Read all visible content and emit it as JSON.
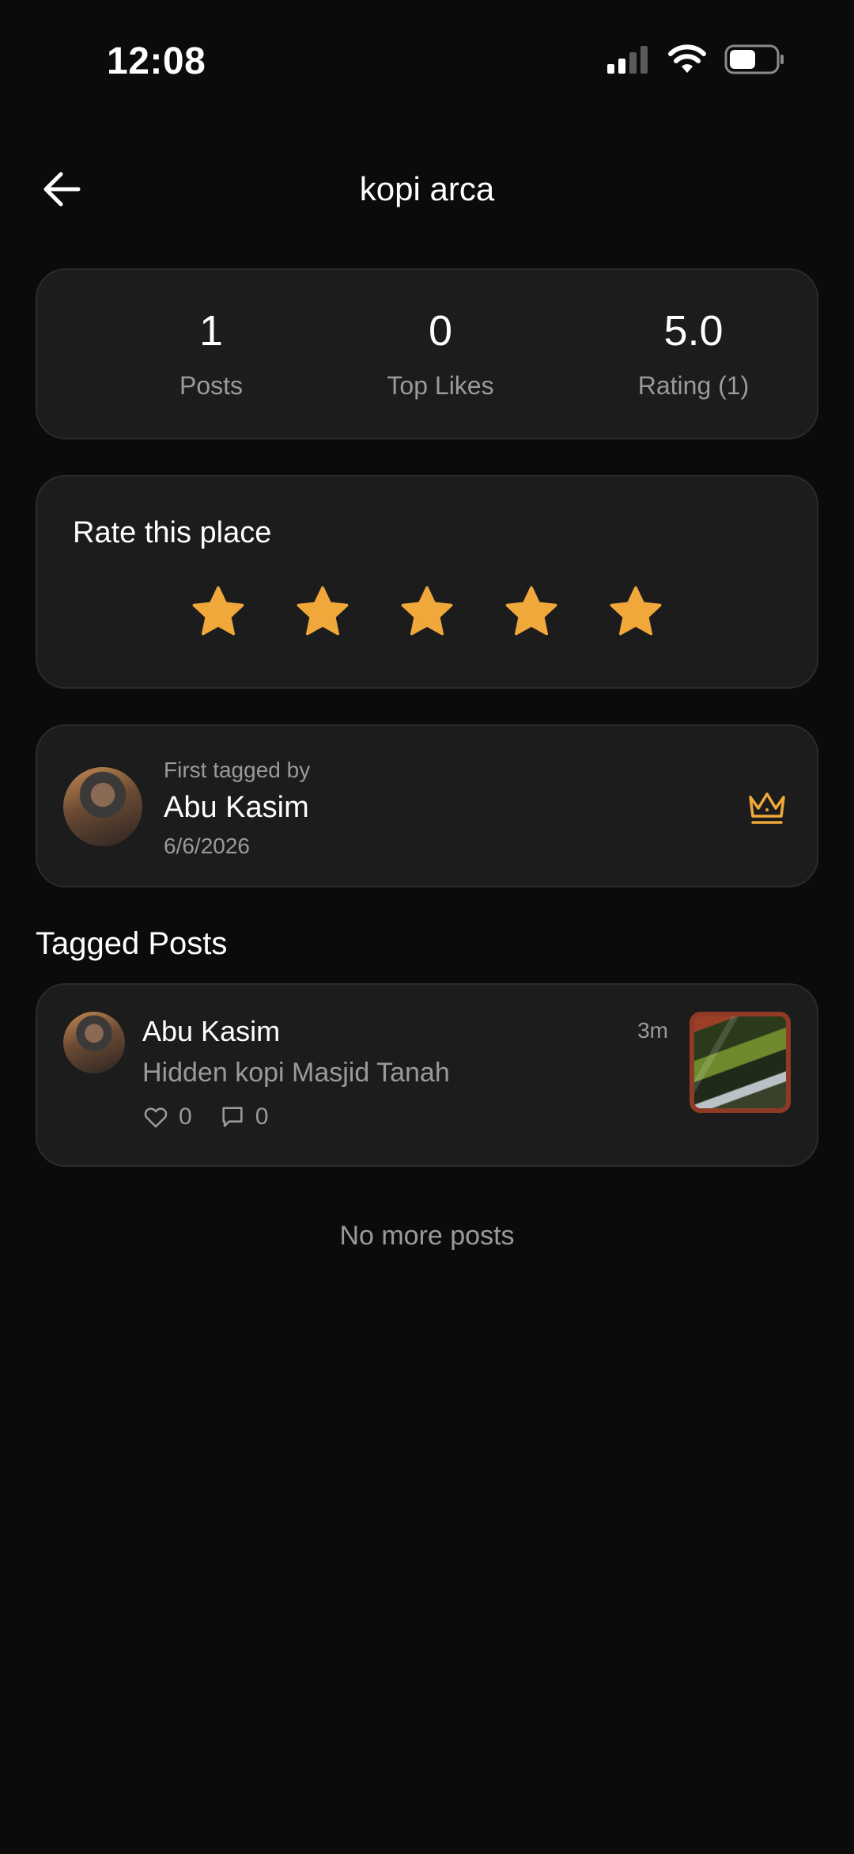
{
  "status_bar": {
    "time": "12:08",
    "icons": [
      "signal-icon",
      "wifi-icon",
      "battery-icon"
    ]
  },
  "header": {
    "title": "kopi arca",
    "back_icon": "arrow-left-icon"
  },
  "stats": [
    {
      "value": "1",
      "label": "Posts"
    },
    {
      "value": "0",
      "label": "Top Likes"
    },
    {
      "value": "5.0",
      "label": "Rating (1)"
    }
  ],
  "rate": {
    "title": "Rate this place",
    "selected_stars": 5,
    "max_stars": 5,
    "star_color": "#F0A83A"
  },
  "first_tagged": {
    "label": "First tagged by",
    "name": "Abu Kasim",
    "date": "6/6/2026",
    "badge_icon": "crown-icon"
  },
  "tagged_posts": {
    "title": "Tagged Posts",
    "items": [
      {
        "author": "Abu Kasim",
        "time": "3m",
        "text": "Hidden kopi Masjid Tanah",
        "likes": "0",
        "comments": "0"
      }
    ],
    "end_text": "No more posts"
  },
  "colors": {
    "background": "#0B0B0B",
    "card": "#1C1C1C",
    "accent": "#F0A83A",
    "muted_text": "#9A9A9A"
  }
}
